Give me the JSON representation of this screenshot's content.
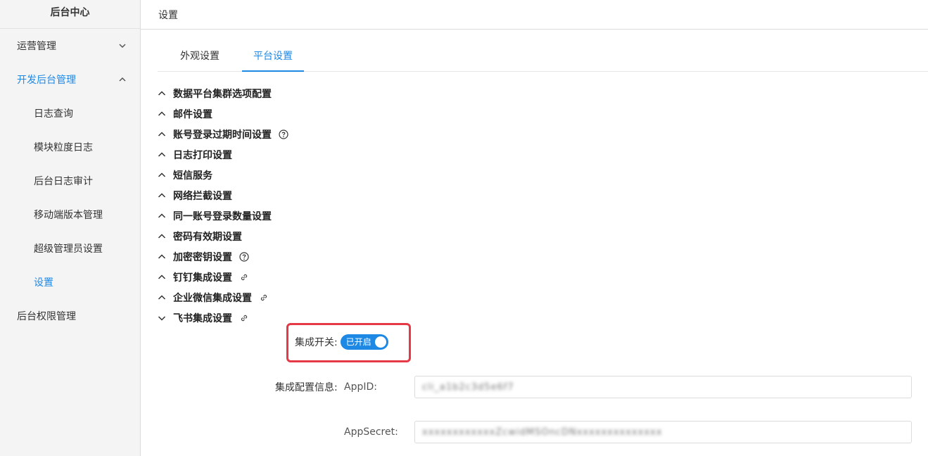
{
  "sidebar": {
    "brand": "后台中心",
    "items": [
      {
        "label": "运营管理",
        "chevron": "down"
      },
      {
        "label": "开发后台管理",
        "chevron": "up",
        "active": true
      },
      {
        "label": "日志查询",
        "sub": true
      },
      {
        "label": "模块粒度日志",
        "sub": true
      },
      {
        "label": "后台日志审计",
        "sub": true
      },
      {
        "label": "移动端版本管理",
        "sub": true
      },
      {
        "label": "超级管理员设置",
        "sub": true
      },
      {
        "label": "设置",
        "sub": true,
        "active": true
      },
      {
        "label": "后台权限管理"
      }
    ]
  },
  "header": {
    "title": "设置"
  },
  "tabs": [
    {
      "label": "外观设置"
    },
    {
      "label": "平台设置",
      "active": true
    }
  ],
  "sections": [
    {
      "label": "数据平台集群选项配置",
      "extra": ""
    },
    {
      "label": "邮件设置",
      "extra": ""
    },
    {
      "label": "账号登录过期时间设置",
      "extra": "help-icon"
    },
    {
      "label": "日志打印设置",
      "extra": ""
    },
    {
      "label": "短信服务",
      "extra": ""
    },
    {
      "label": "网络拦截设置",
      "extra": ""
    },
    {
      "label": "同一账号登录数量设置",
      "extra": ""
    },
    {
      "label": "密码有效期设置",
      "extra": ""
    },
    {
      "label": "加密密钥设置",
      "extra": "help-icon"
    },
    {
      "label": "钉钉集成设置",
      "extra": "link-icon"
    },
    {
      "label": "企业微信集成设置",
      "extra": "link-icon"
    },
    {
      "label": "飞书集成设置",
      "extra": "link-icon",
      "expanded": true
    }
  ],
  "feishu": {
    "switch_label": "集成开关:",
    "switch_text": "已开启",
    "config_label": "集成配置信息:",
    "appid_label": "AppID:",
    "appid_value": "cli_a1b2c3d5e6f7",
    "appsecret_label": "AppSecret:",
    "appsecret_value": "xxxxxxxxxxxxZcwidMSOncDNxxxxxxxxxxxxxx"
  },
  "colors": {
    "accent": "#1e88e5",
    "highlight": "#e53945"
  }
}
